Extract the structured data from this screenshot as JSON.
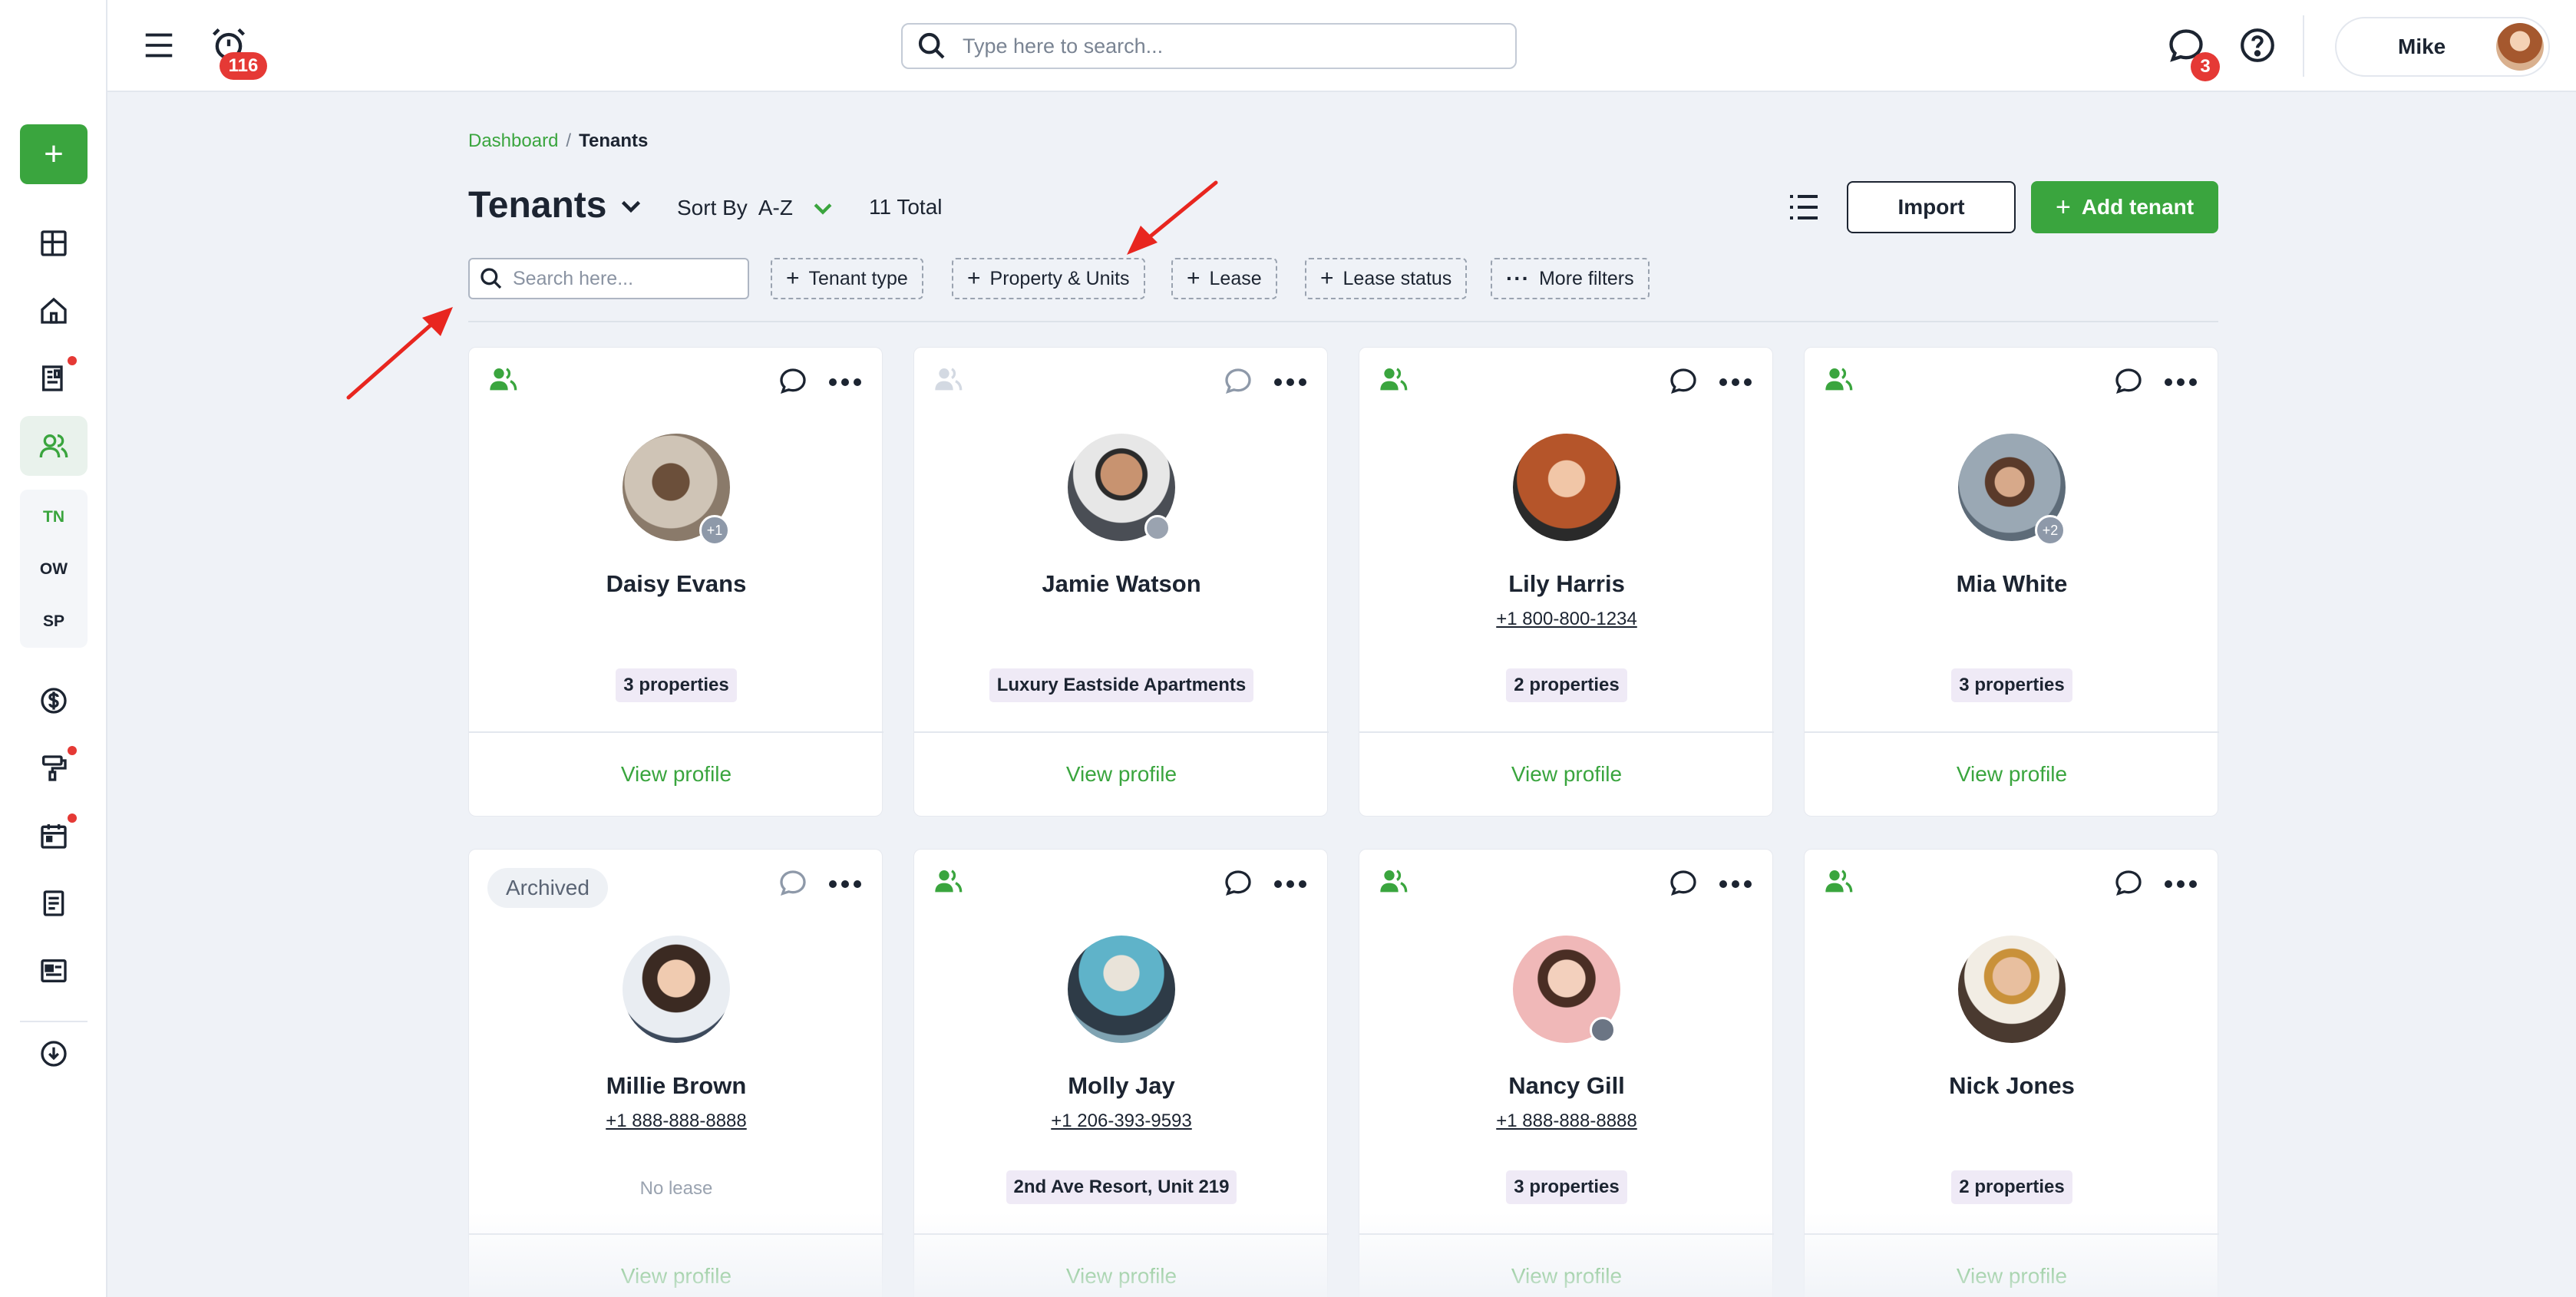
{
  "topbar": {
    "alarm_count": "116",
    "search_placeholder": "Type here to search...",
    "messages_count": "3",
    "user_name": "Mike"
  },
  "sidebar": {
    "sub_items": [
      "TN",
      "OW",
      "SP"
    ]
  },
  "breadcrumb": {
    "root": "Dashboard",
    "separator": "/",
    "current": "Tenants"
  },
  "header": {
    "title": "Tenants",
    "sort_label": "Sort By",
    "sort_value": "A-Z",
    "total": "11 Total",
    "import_label": "Import",
    "add_label": "Add tenant"
  },
  "filters": {
    "search_placeholder": "Search here...",
    "tenant_type": "Tenant type",
    "property_units": "Property & Units",
    "lease": "Lease",
    "lease_status": "Lease status",
    "more_filters": "More filters"
  },
  "cards": [
    {
      "name": "Daisy Evans",
      "phone": "",
      "property": "3 properties",
      "view": "View profile",
      "badge": "+1"
    },
    {
      "name": "Jamie Watson",
      "phone": "",
      "property": "Luxury Eastside Apartments",
      "view": "View profile",
      "badge": ""
    },
    {
      "name": "Lily Harris",
      "phone": "+1 800-800-1234",
      "property": "2 properties",
      "view": "View profile",
      "badge": ""
    },
    {
      "name": "Mia White",
      "phone": "",
      "property": "3 properties",
      "view": "View profile",
      "badge": "+2"
    },
    {
      "name": "Millie Brown",
      "phone": "+1 888-888-8888",
      "status": "Archived",
      "no_lease": "No lease",
      "view": "View profile",
      "badge": ""
    },
    {
      "name": "Molly Jay",
      "phone": "+1 206-393-9593",
      "property": "2nd Ave Resort, Unit 219",
      "view": "View profile",
      "badge": ""
    },
    {
      "name": "Nancy Gill",
      "phone": "+1 888-888-8888",
      "property": "3 properties",
      "view": "View profile",
      "badge": ""
    },
    {
      "name": "Nick Jones",
      "phone": "",
      "property": "2 properties",
      "view": "View profile",
      "badge": ""
    }
  ],
  "colors": {
    "brand_green": "#3aa53e",
    "badge_red": "#e53935",
    "annotation_red": "#e8261f"
  }
}
